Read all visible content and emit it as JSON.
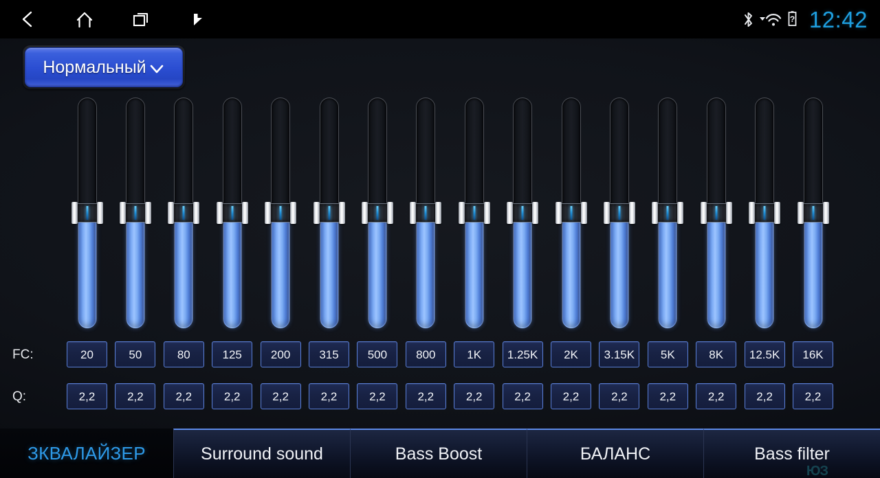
{
  "statusbar": {
    "nav": [
      {
        "name": "back-icon",
        "label": "Back"
      },
      {
        "name": "home-icon",
        "label": "Home"
      },
      {
        "name": "recents-icon",
        "label": "Recent apps"
      },
      {
        "name": "flag-icon",
        "label": "Flag"
      }
    ],
    "icons": [
      {
        "name": "bluetooth-icon",
        "label": "Bluetooth"
      },
      {
        "name": "wifi-icon",
        "label": "Wi-Fi"
      },
      {
        "name": "battery-unknown-icon",
        "label": "Battery unknown"
      }
    ],
    "clock": "12:42",
    "clock_color": "#1e9fe0"
  },
  "preset": {
    "label": "Нормальный",
    "chevron": "chevron-down-icon",
    "accent": "#2b4ed2"
  },
  "equalizer": {
    "band_count": 16,
    "fc_row_label": "FC:",
    "q_row_label": "Q:",
    "fill_color": "#7aaaf2",
    "box_border": "#5a7fd8",
    "bands": [
      {
        "fc": "20",
        "q": "2,2",
        "level": 50
      },
      {
        "fc": "50",
        "q": "2,2",
        "level": 50
      },
      {
        "fc": "80",
        "q": "2,2",
        "level": 50
      },
      {
        "fc": "125",
        "q": "2,2",
        "level": 50
      },
      {
        "fc": "200",
        "q": "2,2",
        "level": 50
      },
      {
        "fc": "315",
        "q": "2,2",
        "level": 50
      },
      {
        "fc": "500",
        "q": "2,2",
        "level": 50
      },
      {
        "fc": "800",
        "q": "2,2",
        "level": 50
      },
      {
        "fc": "1K",
        "q": "2,2",
        "level": 50
      },
      {
        "fc": "1.25K",
        "q": "2,2",
        "level": 50
      },
      {
        "fc": "2K",
        "q": "2,2",
        "level": 50
      },
      {
        "fc": "3.15K",
        "q": "2,2",
        "level": 50
      },
      {
        "fc": "5K",
        "q": "2,2",
        "level": 50
      },
      {
        "fc": "8K",
        "q": "2,2",
        "level": 50
      },
      {
        "fc": "12.5K",
        "q": "2,2",
        "level": 50
      },
      {
        "fc": "16K",
        "q": "2,2",
        "level": 50
      }
    ]
  },
  "tabs": [
    {
      "label": "ЗКВАЛАЙЗЕР",
      "active": true
    },
    {
      "label": "Surround sound",
      "active": false
    },
    {
      "label": "Bass Boost",
      "active": false
    },
    {
      "label": "БАЛАНС",
      "active": false
    },
    {
      "label": "Bass filter",
      "active": false
    }
  ],
  "tab_artifact": "ЮЗ"
}
